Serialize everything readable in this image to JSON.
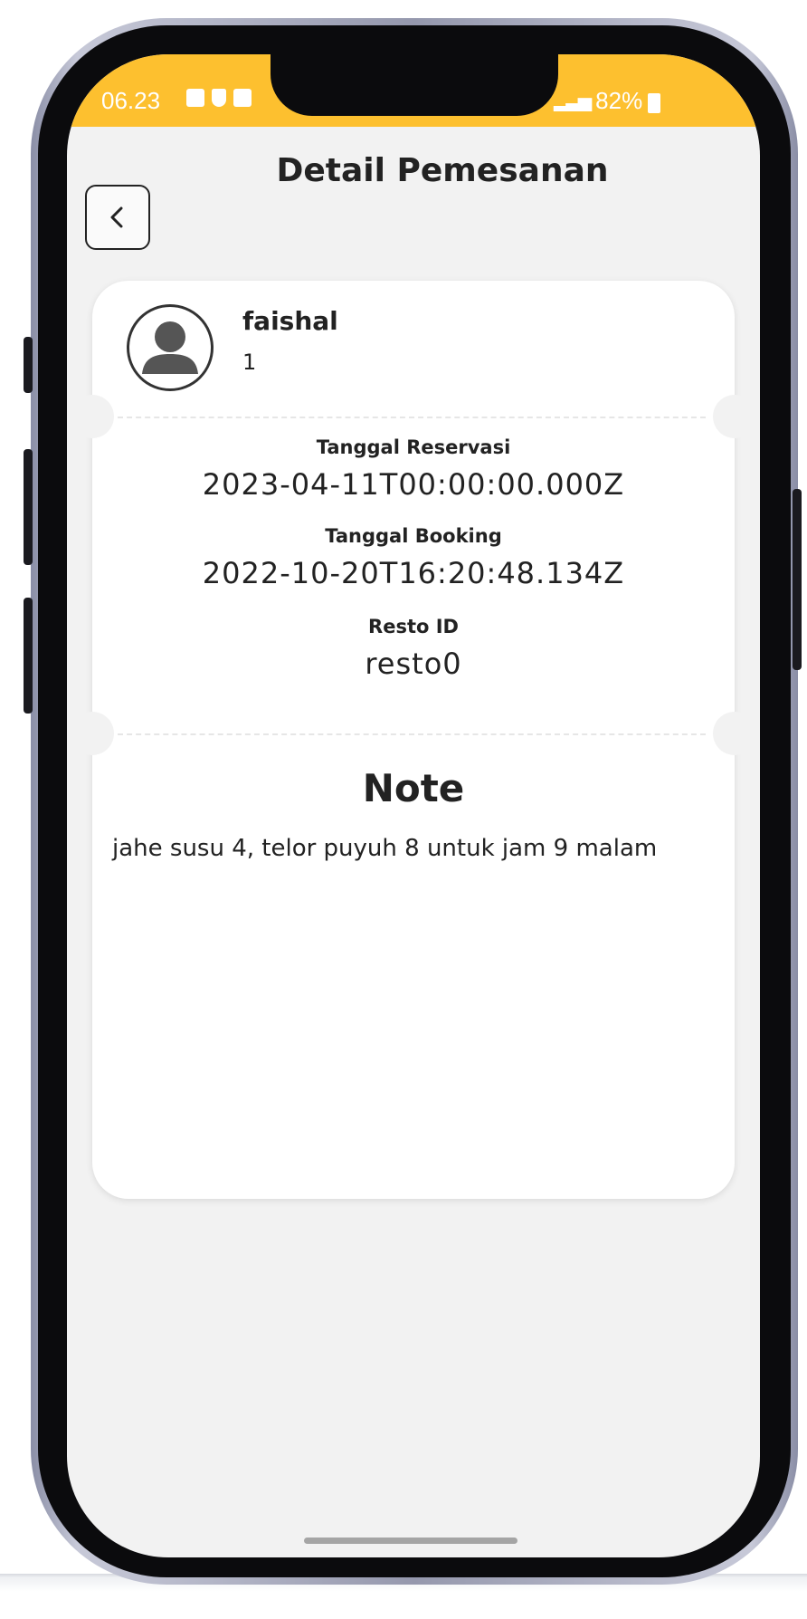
{
  "status_bar": {
    "time": "06.23",
    "battery": "82%",
    "background_color": "#fdc02f",
    "left_icons": [
      "gallery-icon",
      "shield-icon",
      "checkbox-icon"
    ],
    "right_icons": [
      "signal-icon",
      "battery-icon"
    ]
  },
  "header": {
    "title": "Detail Pemesanan",
    "back_icon": "chevron-left-icon"
  },
  "user": {
    "name": "faishal",
    "id": "1",
    "avatar_icon": "user-avatar-icon"
  },
  "reservation": {
    "tanggal_reservasi_label": "Tanggal Reservasi",
    "tanggal_reservasi_value": "2023-04-11T00:00:00.000Z",
    "tanggal_booking_label": "Tanggal Booking",
    "tanggal_booking_value": "2022-10-20T16:20:48.134Z",
    "resto_id_label": "Resto ID",
    "resto_id_value": "resto0"
  },
  "note": {
    "title": "Note",
    "text": "jahe susu 4, telor puyuh 8 untuk jam 9 malam"
  }
}
